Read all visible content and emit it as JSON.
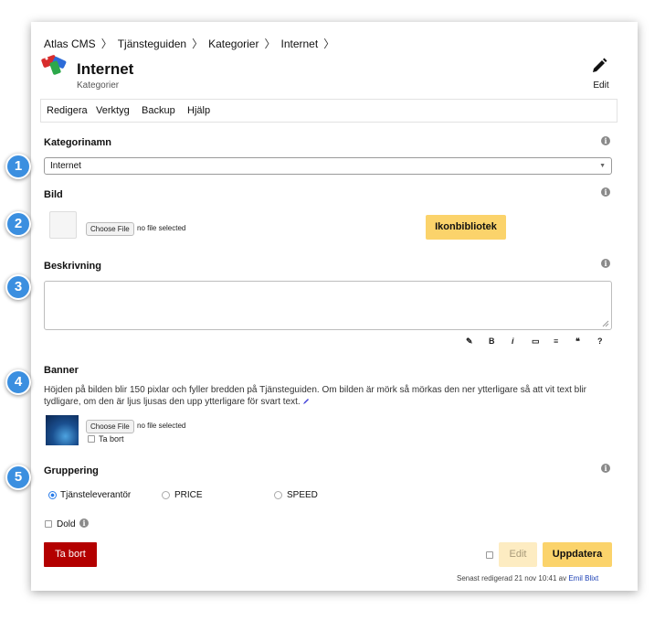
{
  "breadcrumb": [
    "Atlas CMS",
    "Tjänsteguiden",
    "Kategorier",
    "Internet"
  ],
  "header": {
    "title": "Internet",
    "subtitle": "Kategorier",
    "edit_label": "Edit"
  },
  "menu": [
    "Redigera",
    "Verktyg",
    "Backup",
    "Hjälp"
  ],
  "fields": {
    "category": {
      "label": "Kategorinamn",
      "value": "Internet"
    },
    "image": {
      "label": "Bild",
      "choose_file": "Choose File",
      "no_file": "no file selected",
      "library_button": "Ikonbibliotek"
    },
    "description": {
      "label": "Beskrivning",
      "toolbar": [
        "✎",
        "B",
        "i",
        "▭",
        "≡",
        "❝",
        "?"
      ]
    },
    "banner": {
      "label": "Banner",
      "help": "Höjden på bilden blir 150 pixlar och fyller bredden på Tjänsteguiden. Om bilden är mörk så mörkas den ner ytterligare så att vit text blir tydligare, om den är ljus ljusas den upp ytterligare för svart text.",
      "choose_file": "Choose File",
      "no_file": "no file selected",
      "remove_label": "Ta bort"
    },
    "grouping": {
      "label": "Gruppering",
      "options": [
        "Tjänsteleverantör",
        "PRICE",
        "SPEED"
      ],
      "selected": "Tjänsteleverantör"
    },
    "hidden": {
      "label": "Dold"
    }
  },
  "actions": {
    "delete": "Ta bort",
    "edit": "Edit",
    "update": "Uppdatera"
  },
  "footer": {
    "text": "Senast redigerad 21 nov 10:41 av",
    "user": "Emil Blixt"
  },
  "steps": [
    "1",
    "2",
    "3",
    "4",
    "5"
  ],
  "colors": {
    "accent_yellow": "#fbd36b",
    "danger": "#b30000",
    "step_blue": "#3b8fe0"
  }
}
